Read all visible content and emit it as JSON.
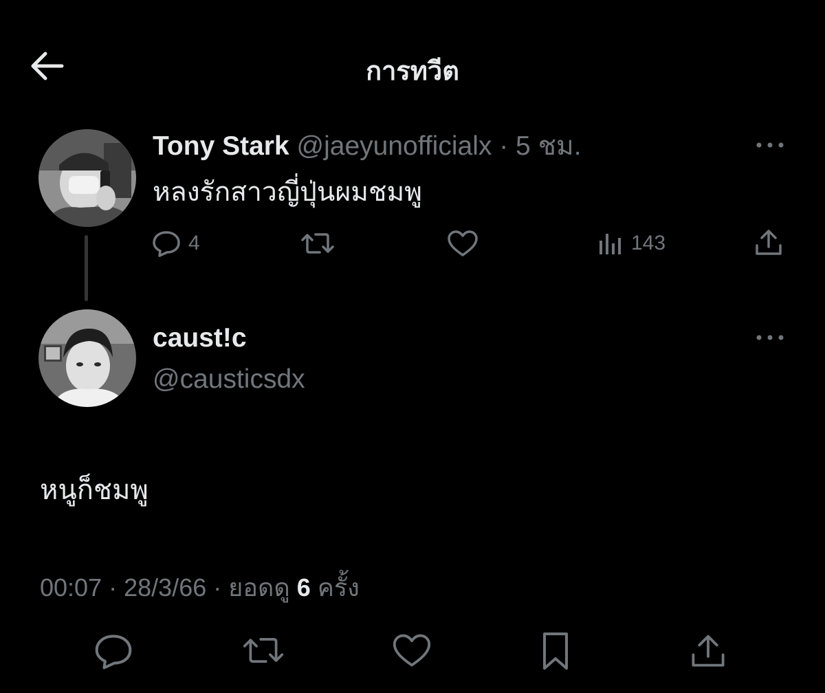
{
  "header": {
    "title": "การทวีต",
    "back_icon": "arrow-left-icon"
  },
  "tweet_parent": {
    "name": "Tony Stark",
    "handle": "@jaeyunofficialx",
    "separator": "·",
    "time": "5 ชม.",
    "text": "หลงรักสาวญี่ปุ่นผมชมพู",
    "actions": {
      "reply_count": "4",
      "views_count": "143"
    }
  },
  "tweet_main": {
    "name": "caust!c",
    "handle": "@causticsdx",
    "text": "หนูก็ชมพู",
    "meta": {
      "time": "00:07",
      "sep1": "·",
      "date": "28/3/66",
      "sep2": "·",
      "views_prefix": "ยอดดู",
      "views_count": "6",
      "views_suffix": "ครั้ง"
    }
  },
  "colors": {
    "background": "#000000",
    "text": "#e7e9ea",
    "muted": "#71767b",
    "thread_line": "#333639"
  }
}
